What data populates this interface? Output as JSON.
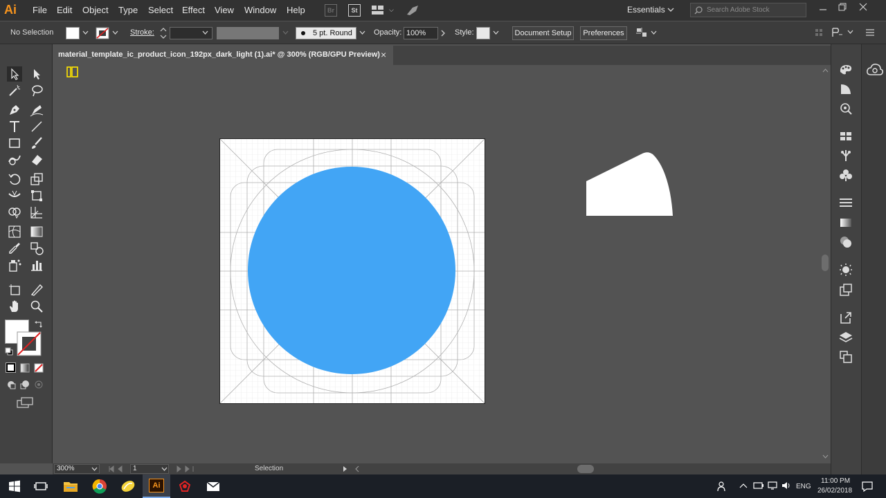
{
  "app": {
    "logo": "Ai",
    "menu": [
      "File",
      "Edit",
      "Object",
      "Type",
      "Select",
      "Effect",
      "View",
      "Window",
      "Help"
    ],
    "bridge_label": "Br",
    "stock_label": "St",
    "workspace": "Essentials",
    "search_placeholder": "Search Adobe Stock"
  },
  "control_bar": {
    "selection_status": "No Selection",
    "stroke_label": "Stroke:",
    "brush_value": "5 pt. Round",
    "opacity_label": "Opacity:",
    "opacity_value": "100%",
    "style_label": "Style:",
    "document_setup": "Document Setup",
    "preferences": "Preferences"
  },
  "document": {
    "tab_title": "material_template_ic_product_icon_192px_dark_light (1).ai* @ 300% (RGB/GPU Preview)",
    "close_glyph": "×",
    "circle_color": "#42a5f5"
  },
  "status_bar": {
    "zoom": "300%",
    "artboard_number": "1",
    "tool_name": "Selection"
  },
  "taskbar": {
    "time": "11:00 PM",
    "date": "26/02/2018",
    "language": "ENG"
  },
  "icons": {
    "toolbar": [
      "selection-tool-icon",
      "direct-selection-tool-icon",
      "magic-wand-tool-icon",
      "lasso-tool-icon",
      "pen-tool-icon",
      "curvature-tool-icon",
      "type-tool-icon",
      "line-segment-tool-icon",
      "rectangle-tool-icon",
      "paintbrush-tool-icon",
      "shaper-tool-icon",
      "eraser-tool-icon",
      "rotate-tool-icon",
      "scale-tool-icon",
      "width-tool-icon",
      "free-transform-tool-icon",
      "shape-builder-tool-icon",
      "perspective-grid-tool-icon",
      "mesh-tool-icon",
      "gradient-tool-icon",
      "eyedropper-tool-icon",
      "blend-tool-icon",
      "symbol-sprayer-tool-icon",
      "column-graph-tool-icon",
      "artboard-tool-icon",
      "slice-tool-icon",
      "hand-tool-icon",
      "zoom-tool-icon"
    ]
  }
}
